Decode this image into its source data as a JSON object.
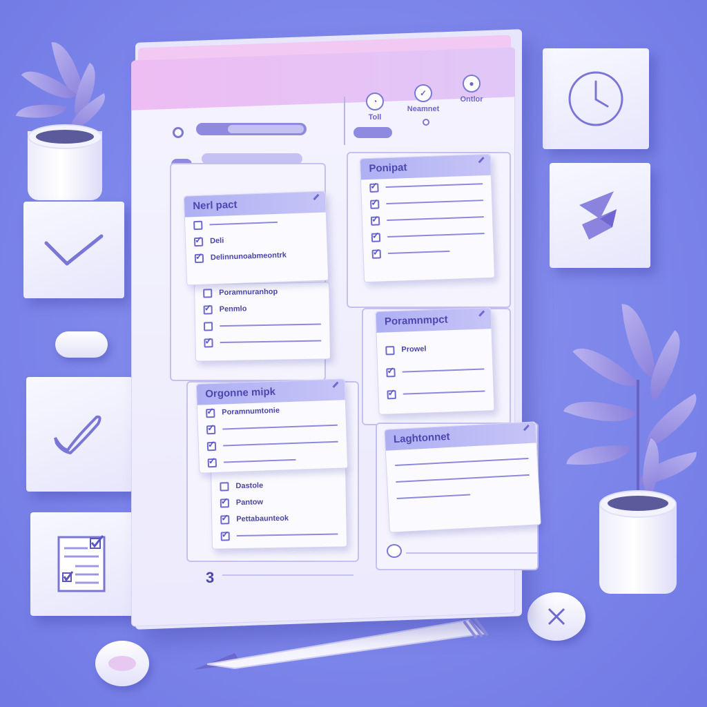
{
  "header": {
    "tabs": [
      {
        "label": "Toll",
        "icon": "tag-icon"
      },
      {
        "label": "Neamnet",
        "icon": "check-icon"
      },
      {
        "label": "Ontlor",
        "icon": "person-icon"
      }
    ]
  },
  "cards": {
    "card1": {
      "title": "Nerl pact",
      "items": [
        "",
        "Deli",
        "Delinnunoabmeontrk"
      ]
    },
    "card2": {
      "items": [
        "Poramnuranhop",
        "Penmlo",
        "",
        ""
      ]
    },
    "card3": {
      "title": "Ponipat"
    },
    "card4": {
      "title": "Poramnmpct",
      "items": [
        "Prowel",
        "",
        ""
      ]
    },
    "card5": {
      "title": "Orgonne mipk",
      "items": [
        "Poramnumtonie",
        "",
        "",
        ""
      ]
    },
    "card6": {
      "items": [
        "Dastole",
        "Pantow",
        "Pettabaunteok",
        ""
      ]
    },
    "card7": {
      "title": "Laghtonnet"
    }
  },
  "footer": {
    "page_number": "3"
  },
  "colors": {
    "background": "#7d86ea",
    "accent": "#6e69cf",
    "card_header": "#aeb0f3"
  }
}
